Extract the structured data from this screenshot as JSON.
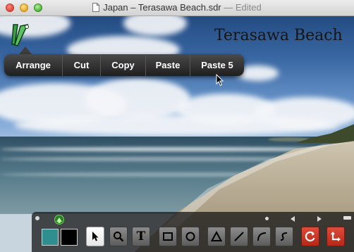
{
  "window": {
    "title": "Japan – Terasawa Beach.sdr",
    "separator": "—",
    "status": "Edited"
  },
  "photo": {
    "title": "Terasawa Beach"
  },
  "context_menu": {
    "items": [
      {
        "id": "arrange",
        "label": "Arrange"
      },
      {
        "id": "cut",
        "label": "Cut"
      },
      {
        "id": "copy",
        "label": "Copy"
      },
      {
        "id": "paste",
        "label": "Paste"
      },
      {
        "id": "paste5",
        "label": "Paste 5"
      }
    ]
  },
  "toolbar": {
    "fill_color": "#2f8f8f",
    "stroke_color": "#000000",
    "tools": [
      {
        "id": "select",
        "icon": "arrow-pointer-icon",
        "selected": true
      },
      {
        "id": "zoom",
        "icon": "magnifier-icon"
      },
      {
        "id": "text",
        "icon": "text-icon",
        "glyph": "T"
      },
      {
        "id": "rect",
        "icon": "rectangle-icon"
      },
      {
        "id": "oval",
        "icon": "circle-icon"
      },
      {
        "id": "polygon",
        "icon": "triangle-icon"
      },
      {
        "id": "line",
        "icon": "line-icon"
      },
      {
        "id": "arc",
        "icon": "arc-icon"
      },
      {
        "id": "curve",
        "icon": "curve-icon"
      },
      {
        "id": "rotate",
        "icon": "rotate-icon"
      },
      {
        "id": "transform",
        "icon": "corner-arrow-icon"
      }
    ]
  }
}
